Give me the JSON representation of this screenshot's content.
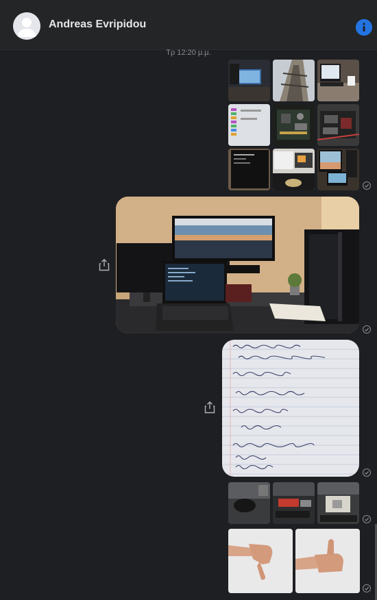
{
  "header": {
    "contact_name": "Andreas Evripidou",
    "avatar_icon": "default-avatar-icon",
    "info_icon": "info-icon",
    "accent": "#2374e1"
  },
  "conversation": {
    "timestamp": "Τρ 12:20 μ.μ.",
    "messages": [
      {
        "kind": "photo-grid",
        "count": 9,
        "status_icon": "seen-check-icon"
      },
      {
        "kind": "single-photo",
        "subject": "desk setup with monitor and laptop",
        "action_icon": "share-icon",
        "status_icon": "seen-check-icon"
      },
      {
        "kind": "single-photo",
        "subject": "handwritten notes on lined paper",
        "action_icon": "share-icon",
        "status_icon": "seen-check-icon"
      },
      {
        "kind": "photo-grid",
        "count": 3,
        "status_icon": "seen-check-icon"
      },
      {
        "kind": "photo-grid",
        "count": 2,
        "subject": "thumbs down and thumbs up",
        "status_icon": "seen-check-icon"
      }
    ]
  }
}
